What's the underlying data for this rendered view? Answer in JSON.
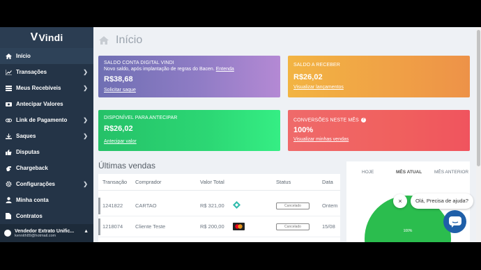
{
  "brand": {
    "name": "Vindi",
    "logo_letter": "V"
  },
  "sidebar": {
    "items": [
      {
        "label": "Início",
        "icon": "home-icon",
        "has_children": false
      },
      {
        "label": "Transações",
        "icon": "chart-icon",
        "has_children": true
      },
      {
        "label": "Meus Recebíveis",
        "icon": "list-icon",
        "has_children": true
      },
      {
        "label": "Antecipar Valores",
        "icon": "money-icon",
        "has_children": false
      },
      {
        "label": "Link de Pagamento",
        "icon": "link-icon",
        "has_children": true
      },
      {
        "label": "Saques",
        "icon": "download-icon",
        "has_children": true
      },
      {
        "label": "Disputas",
        "icon": "thumbs-icon",
        "has_children": false
      },
      {
        "label": "Chargeback",
        "icon": "hand-icon",
        "has_children": false
      },
      {
        "label": "Configurações",
        "icon": "gear-icon",
        "has_children": true
      },
      {
        "label": "Minha conta",
        "icon": "user-icon",
        "has_children": false
      },
      {
        "label": "Contratos",
        "icon": "doc-icon",
        "has_children": false
      }
    ],
    "user": {
      "name": "Vendedor Extrato Unific...",
      "email": "kennith89@hotmail.com"
    }
  },
  "header": {
    "title": "Início"
  },
  "cards": {
    "saldo": {
      "label": "SALDO CONTA DIGITAL VINDI",
      "note": "Novo saldo, após implantação de regras do Bacen.",
      "note_link": "Entenda",
      "value": "R$38,68",
      "link": "Solicitar saque"
    },
    "receber": {
      "label": "SALDO A RECEBER",
      "value": "R$26,02",
      "link": "Visualizar lançamentos"
    },
    "disponivel": {
      "label": "DISPONÍVEL PARA ANTECIPAR",
      "value": "R$26,02",
      "link": "Antecipar valor"
    },
    "conversoes": {
      "label": "CONVERSÕES NESTE MÊS",
      "value": "100%",
      "link": "Visualizar minhas vendas"
    }
  },
  "sales": {
    "title": "Últimas vendas",
    "columns": [
      "Transação",
      "Comprador",
      "Valor Total",
      "Status",
      "Data"
    ],
    "rows": [
      {
        "id": "1241822",
        "buyer": "CARTAO",
        "total": "R$ 321,00",
        "method": "pix-icon",
        "status": "Cancelado",
        "date": "Ontem"
      },
      {
        "id": "1218074",
        "buyer": "Cliente Teste",
        "total": "R$ 200,00",
        "method": "mastercard-icon",
        "status": "Cancelado",
        "date": "15/08"
      }
    ]
  },
  "panel": {
    "tabs": [
      "HOJE",
      "MÊS ATUAL",
      "MÊS ANTERIOR"
    ],
    "active_tab": "MÊS ATUAL",
    "pie_label": "100%",
    "pie_color": "#2bbd4e"
  },
  "chat": {
    "greeting": "Olá, Precisa de ajuda?",
    "close": "×"
  }
}
